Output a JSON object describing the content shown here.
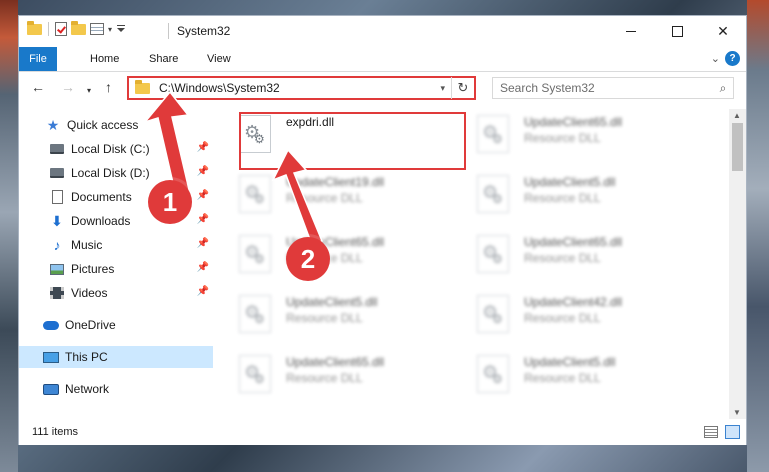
{
  "window": {
    "title": "System32",
    "controls": {
      "minimize": "—",
      "maximize": "",
      "close": "✕"
    }
  },
  "ribbon": {
    "tabs": [
      "File",
      "Home",
      "Share",
      "View"
    ],
    "expand_icon": "chevron-down-icon",
    "help": "?"
  },
  "nav": {
    "back": "←",
    "forward": "→",
    "recent": "▾",
    "up": "↑",
    "address": "C:\\Windows\\System32",
    "refresh": "↻",
    "search_placeholder": "Search System32",
    "search_icon": "⌕"
  },
  "sidebar": {
    "items": [
      {
        "label": "Quick access",
        "icon": "star-icon",
        "pinned": false
      },
      {
        "label": "Local Disk (C:)",
        "icon": "drive-icon",
        "pinned": true
      },
      {
        "label": "Local Disk (D:)",
        "icon": "drive-icon",
        "pinned": true
      },
      {
        "label": "Documents",
        "icon": "document-icon",
        "pinned": true
      },
      {
        "label": "Downloads",
        "icon": "download-icon",
        "pinned": true
      },
      {
        "label": "Music",
        "icon": "music-icon",
        "pinned": true
      },
      {
        "label": "Pictures",
        "icon": "pictures-icon",
        "pinned": true
      },
      {
        "label": "Videos",
        "icon": "videos-icon",
        "pinned": true
      },
      {
        "label": "OneDrive",
        "icon": "cloud-icon",
        "pinned": false
      },
      {
        "label": "This PC",
        "icon": "pc-icon",
        "pinned": false,
        "selected": true
      },
      {
        "label": "Network",
        "icon": "network-icon",
        "pinned": false
      }
    ]
  },
  "files": {
    "highlighted": {
      "name": "expdri.dll",
      "type": ""
    },
    "left_column": [
      {
        "name": "UpdateClient19.dll",
        "type": "Resource DLL"
      },
      {
        "name": "UpdateClient65.dll",
        "type": "Resource DLL"
      },
      {
        "name": "UpdateClient5.dll",
        "type": "Resource DLL"
      },
      {
        "name": "UpdateClient65.dll",
        "type": "Resource DLL"
      }
    ],
    "right_column": [
      {
        "name": "UpdateClient65.dll",
        "type": "Resource DLL"
      },
      {
        "name": "UpdateClient5.dll",
        "type": "Resource DLL"
      },
      {
        "name": "UpdateClient65.dll",
        "type": "Resource DLL"
      },
      {
        "name": "UpdateClient42.dll",
        "type": "Resource DLL"
      },
      {
        "name": "UpdateClient5.dll",
        "type": "Resource DLL"
      }
    ]
  },
  "status": {
    "count": "111 items"
  },
  "annotations": {
    "marker1": "1",
    "marker2": "2",
    "color": "#e03a3a"
  }
}
